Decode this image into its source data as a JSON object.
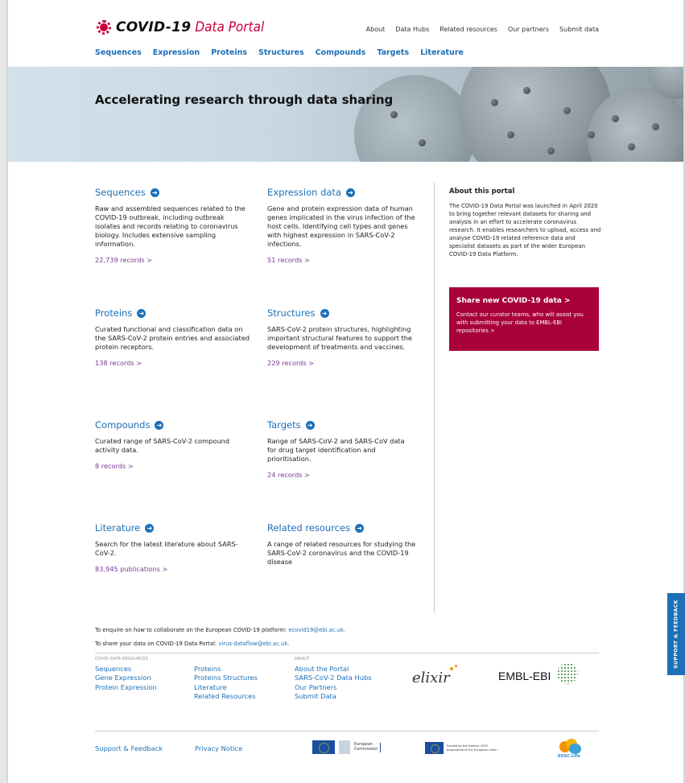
{
  "header": {
    "logo_main": "COVID-19",
    "logo_sub": "Data Portal",
    "top_nav": [
      "About",
      "Data Hubs",
      "Related resources",
      "Our partners",
      "Submit data"
    ],
    "main_nav": [
      "Sequences",
      "Expression",
      "Proteins",
      "Structures",
      "Compounds",
      "Targets",
      "Literature"
    ]
  },
  "hero": {
    "title": "Accelerating research through data sharing"
  },
  "sections": [
    {
      "title": "Sequences",
      "desc": "Raw and assembled sequences related to the COVID-19 outbreak, including outbreak isolates and records relating to coronavirus biology. Includes extensive sampling information.",
      "records": "22,739 records >"
    },
    {
      "title": "Expression data",
      "desc": "Gene and protein expression data of human genes implicated in the virus infection of the host cells. Identifying cell types and genes with highest expression in SARS-CoV-2 infections.",
      "records": "51 records >"
    },
    {
      "title": "Proteins",
      "desc": "Curated functional and classification data on the SARS-CoV-2 protein entries and associated protein receptors.",
      "records": "138 records >"
    },
    {
      "title": "Structures",
      "desc": "SARS-CoV-2 protein structures, highlighting important structural features to support the development of treatments and vaccines.",
      "records": "229 records >"
    },
    {
      "title": "Compounds",
      "desc": "Curated range of SARS-CoV-2 compound activity data.",
      "records": "8 records >"
    },
    {
      "title": "Targets",
      "desc": "Range of SARS-CoV-2 and SARS-CoV data for drug target identification and prioritisation.",
      "records": "24 records >"
    },
    {
      "title": "Literature",
      "desc": "Search for the latest literature about SARS-CoV-2.",
      "records": "83,945 publications >"
    },
    {
      "title": "Related resources",
      "desc": "A range of related resources for studying the SARS-CoV-2 coronavirus and the COVID-19 disease",
      "records": ""
    }
  ],
  "about": {
    "title": "About this portal",
    "text": "The COVID-19 Data Portal was launched in April 2020 to bring together relevant datasets for sharing and analysis in an effort to accelerate coronavirus research. It enables researchers to upload, access and analyse COVID-19 related reference data and specialist datasets as part of the wider European COVID-19 Data Platform."
  },
  "share": {
    "title": "Share new COVID-19 data >",
    "text": "Contact our curator teams, who will assist you with submitting your data to EMBL-EBI repositories >"
  },
  "footer": {
    "enquire_text": "To enquire on how to collaborate on the European COVID-19 platform:",
    "enquire_email": "ecovid19@ebi.ac.uk.",
    "share_text": "To share your data on COVID-19 Data Portal:",
    "share_email": "virus-dataflow@ebi.ac.uk.",
    "col1_head": "COVID DATA RESOURCES",
    "col1": [
      "Sequences",
      "Gene Expression",
      "Protein Expression"
    ],
    "col2": [
      "Proteins",
      "Proteins Structures",
      "Literature",
      "Related Resources"
    ],
    "col3_head": "ABOUT",
    "col3": [
      "About the Portal",
      "SARS-CoV-2 Data Hubs",
      "Our Partners",
      "Submit Data"
    ],
    "elixir": "elixir",
    "embl": "EMBL-EBI",
    "support_link": "Support & Feedback",
    "privacy_link": "Privacy Notice",
    "ec_text_1": "European",
    "ec_text_2": "Commission",
    "h2020_text": "Funded by the Horizon 2020 programme of the European Union",
    "eosc_text": "EOSC-Life"
  },
  "support_tab": "SUPPORT & FEEDBACK",
  "colors": {
    "link_blue": "#1d70b8",
    "brand_red": "#c7003c",
    "share_bg": "#a8003a",
    "records_purple": "#7b3a96"
  }
}
